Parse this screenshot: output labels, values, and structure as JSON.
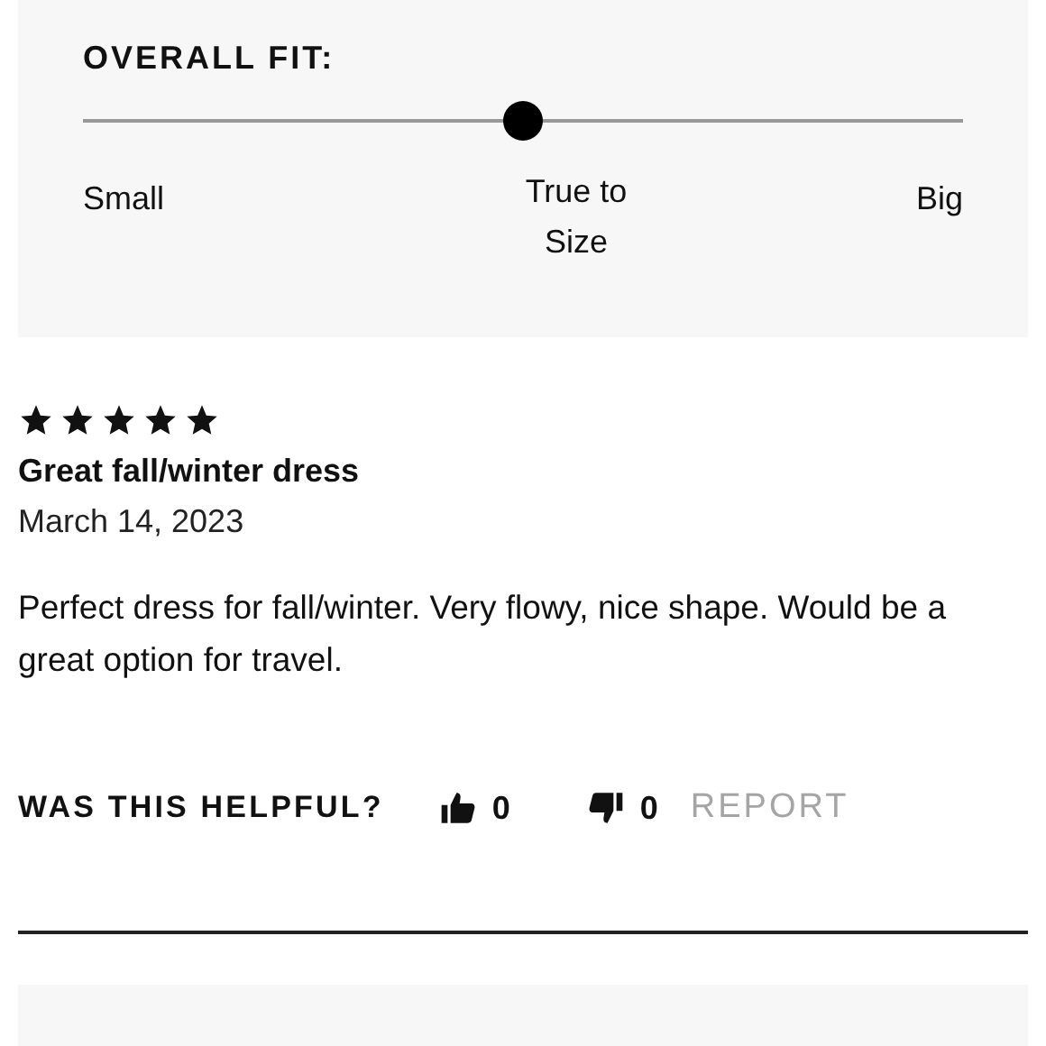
{
  "fit": {
    "title": "OVERALL FIT:",
    "level": 0.5,
    "labels": [
      "Small",
      "True to Size",
      "Big"
    ]
  },
  "review": {
    "stars": 5,
    "title": "Great fall/winter dress",
    "date": "March 14, 2023",
    "body": "Perfect dress for fall/winter. Very flowy, nice shape. Would be a great option for travel.",
    "helpful": {
      "label": "WAS THIS HELPFUL?",
      "up_count": "0",
      "down_count": "0",
      "report": "REPORT"
    }
  }
}
